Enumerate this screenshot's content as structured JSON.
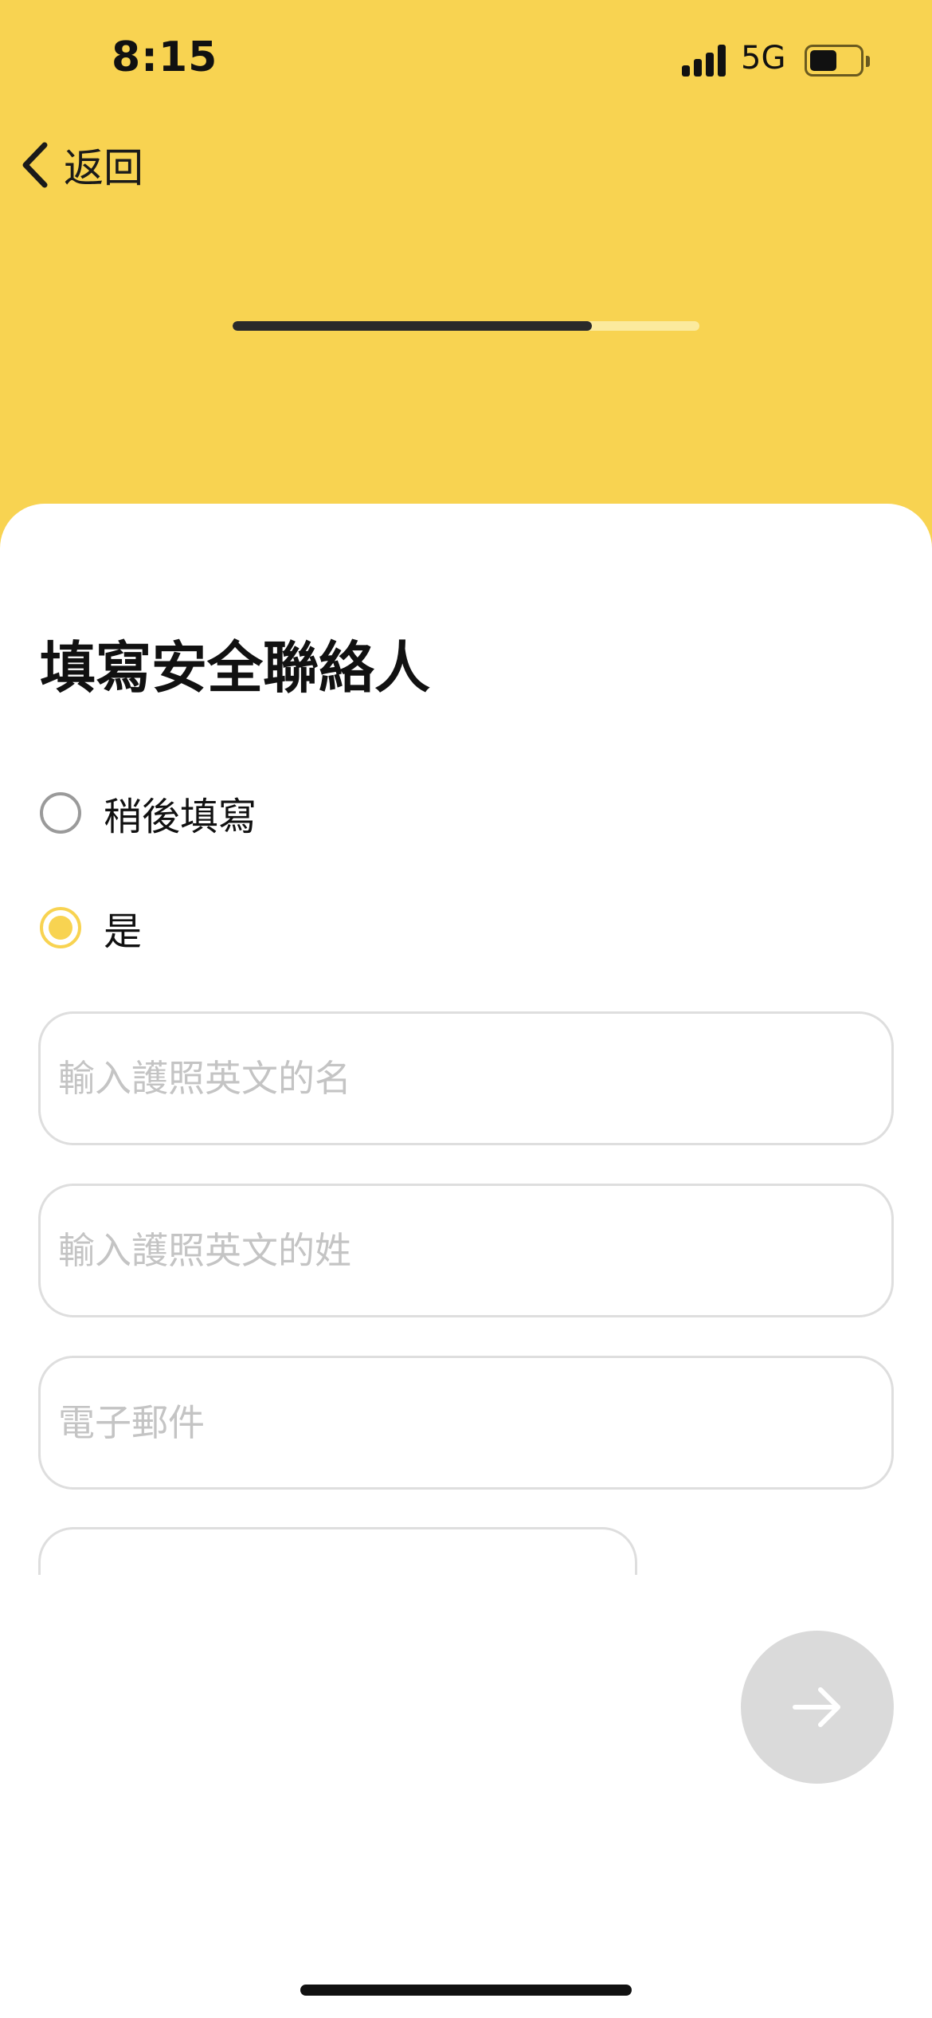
{
  "status_bar": {
    "time": "8:15",
    "network": "5G",
    "battery_level": 0.55
  },
  "nav": {
    "back_label": "返回"
  },
  "progress": {
    "value": 0.77
  },
  "form": {
    "title": "填寫安全聯絡人",
    "options": [
      {
        "label": "稍後填寫",
        "checked": false
      },
      {
        "label": "是",
        "checked": true
      }
    ],
    "fields": [
      {
        "placeholder": "輸入護照英文的名",
        "value": ""
      },
      {
        "placeholder": "輸入護照英文的姓",
        "value": ""
      },
      {
        "placeholder": "電子郵件",
        "value": ""
      }
    ]
  },
  "colors": {
    "brand_yellow": "#F8D351",
    "button_disabled": "#DADADA"
  },
  "icons": {
    "back": "chevron-left-icon",
    "next": "arrow-right-icon"
  }
}
